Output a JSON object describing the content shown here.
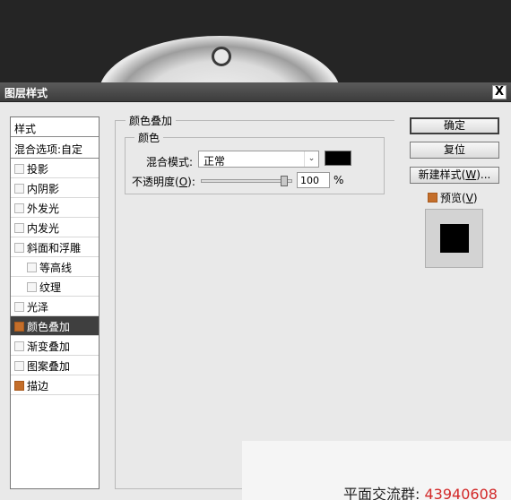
{
  "dialog": {
    "title": "图层样式",
    "close_glyph": "X"
  },
  "styles_list": {
    "header": "样式",
    "blend_options": "混合选项:自定",
    "items": [
      {
        "label": "投影",
        "checked": false,
        "indent": false,
        "selected": false
      },
      {
        "label": "内阴影",
        "checked": false,
        "indent": false,
        "selected": false
      },
      {
        "label": "外发光",
        "checked": false,
        "indent": false,
        "selected": false
      },
      {
        "label": "内发光",
        "checked": false,
        "indent": false,
        "selected": false
      },
      {
        "label": "斜面和浮雕",
        "checked": false,
        "indent": false,
        "selected": false
      },
      {
        "label": "等高线",
        "checked": false,
        "indent": true,
        "selected": false
      },
      {
        "label": "纹理",
        "checked": false,
        "indent": true,
        "selected": false
      },
      {
        "label": "光泽",
        "checked": false,
        "indent": false,
        "selected": false
      },
      {
        "label": "颜色叠加",
        "checked": true,
        "indent": false,
        "selected": true
      },
      {
        "label": "渐变叠加",
        "checked": false,
        "indent": false,
        "selected": false
      },
      {
        "label": "图案叠加",
        "checked": false,
        "indent": false,
        "selected": false
      },
      {
        "label": "描边",
        "checked": true,
        "indent": false,
        "selected": false
      }
    ]
  },
  "color_overlay": {
    "group_title": "颜色叠加",
    "sub_title": "颜色",
    "blend_mode_label": "混合模式:",
    "blend_mode_value": "正常",
    "overlay_color": "#000000",
    "opacity_label": "不透明度(O):",
    "opacity_value": "100",
    "opacity_fraction": 1.0,
    "opacity_unit": "%"
  },
  "buttons": {
    "ok": "确定",
    "reset": "复位",
    "new_style": "新建样式(W)..."
  },
  "preview": {
    "label": "预览(V)",
    "checked": true
  },
  "watermark": {
    "text": "平面交流群:",
    "number": "43940608"
  },
  "colors": {
    "accent_checkbox": "#c46e2a",
    "selected_row": "#3f3f3f",
    "watermark_number": "#d22828"
  }
}
